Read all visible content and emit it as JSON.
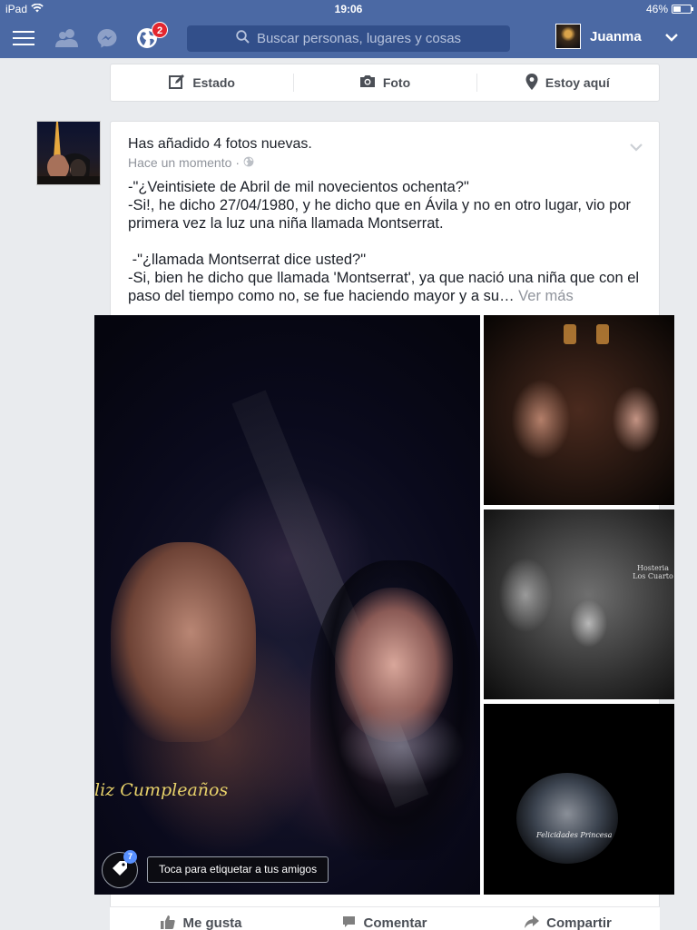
{
  "status": {
    "device": "iPad",
    "time": "19:06",
    "battery": "46%",
    "battery_level": 0.46
  },
  "nav": {
    "notifications_badge": "2",
    "search_placeholder": "Buscar personas, lugares y cosas",
    "user_name": "Juanma"
  },
  "composer": {
    "status_label": "Estado",
    "photo_label": "Foto",
    "checkin_label": "Estoy aquí"
  },
  "post": {
    "title": "Has añadido 4 fotos nuevas.",
    "meta": "Hace un momento",
    "paragraph1_line1": "-\"¿Veintisiete de Abril de mil novecientos ochenta?\"",
    "paragraph1_line2": "-Si!, he dicho 27/04/1980, y he dicho que en Ávila y no en otro lugar, vio por primera vez la luz una niña llamada Montserrat.",
    "paragraph2_line1": " -\"¿llamada Montserrat dice usted?\"",
    "paragraph2_line2": "-Si, bien he dicho que llamada 'Montserrat', ya que nació una niña que con el paso del tiempo como no, se fue haciendo mayor y a su…",
    "see_more": "Ver más"
  },
  "photos": {
    "main_caption": "liz Cumpleaños",
    "tag_count": "7",
    "tag_hint": "Toca para etiquetar a tus amigos",
    "sign_text": "Hosteria Los Cuarto",
    "photo4_caption": "Felicidades Princesa"
  },
  "actions": {
    "like": "Me gusta",
    "comment": "Comentar",
    "share": "Compartir"
  },
  "colors": {
    "brand": "#4b69a4",
    "search_bg": "#324f8a",
    "badge": "#e3262e",
    "tag_count": "#5890ff"
  }
}
